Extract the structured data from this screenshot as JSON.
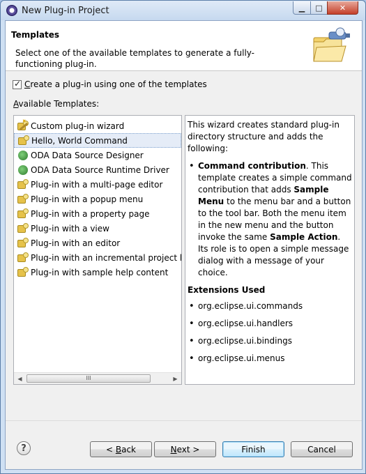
{
  "window": {
    "title": "New Plug-in Project",
    "minimize_glyph": "▁",
    "maximize_glyph": "□",
    "close_glyph": "✕"
  },
  "header": {
    "title": "Templates",
    "description": "Select one of the available templates to generate a fully-functioning plug-in."
  },
  "use_template": {
    "checked": true,
    "label": "Create a plug-in using one of the templates"
  },
  "available_label": "Available Templates:",
  "templates": [
    {
      "label": "Custom plug-in wizard",
      "icon": "wizard-icon",
      "selected": false
    },
    {
      "label": "Hello, World Command",
      "icon": "plugin-icon",
      "selected": true
    },
    {
      "label": "ODA Data Source Designer",
      "icon": "oda-icon",
      "selected": false
    },
    {
      "label": "ODA Data Source Runtime Driver",
      "icon": "oda-icon",
      "selected": false
    },
    {
      "label": "Plug-in with a multi-page editor",
      "icon": "plugin-icon",
      "selected": false
    },
    {
      "label": "Plug-in with a popup menu",
      "icon": "plugin-icon",
      "selected": false
    },
    {
      "label": "Plug-in with a property page",
      "icon": "plugin-icon",
      "selected": false
    },
    {
      "label": "Plug-in with a view",
      "icon": "plugin-icon",
      "selected": false
    },
    {
      "label": "Plug-in with an editor",
      "icon": "plugin-icon",
      "selected": false
    },
    {
      "label": "Plug-in with an incremental project bu",
      "icon": "plugin-icon",
      "selected": false
    },
    {
      "label": "Plug-in with sample help content",
      "icon": "plugin-icon",
      "selected": false
    }
  ],
  "scrollbar": {
    "left_arrow": "◀",
    "right_arrow": "▶",
    "grip": "III"
  },
  "description": {
    "intro": "This wizard creates standard plug-in directory structure and adds the following:",
    "item_title": "Command contribution",
    "item_text_1": ". This template creates a simple command contribution that adds ",
    "item_bold_2": "Sample Menu",
    "item_text_3": " to the menu bar and a button to the tool bar. Both the menu item in the new menu and the button invoke the same ",
    "item_bold_4": "Sample Action",
    "item_text_5": ". Its role is to open a simple message dialog with a message of your choice.",
    "extensions_heading": "Extensions Used",
    "extensions": [
      "org.eclipse.ui.commands",
      "org.eclipse.ui.handlers",
      "org.eclipse.ui.bindings",
      "org.eclipse.ui.menus"
    ]
  },
  "buttons": {
    "help": "?",
    "back": "< Back",
    "next": "Next >",
    "finish": "Finish",
    "cancel": "Cancel"
  }
}
